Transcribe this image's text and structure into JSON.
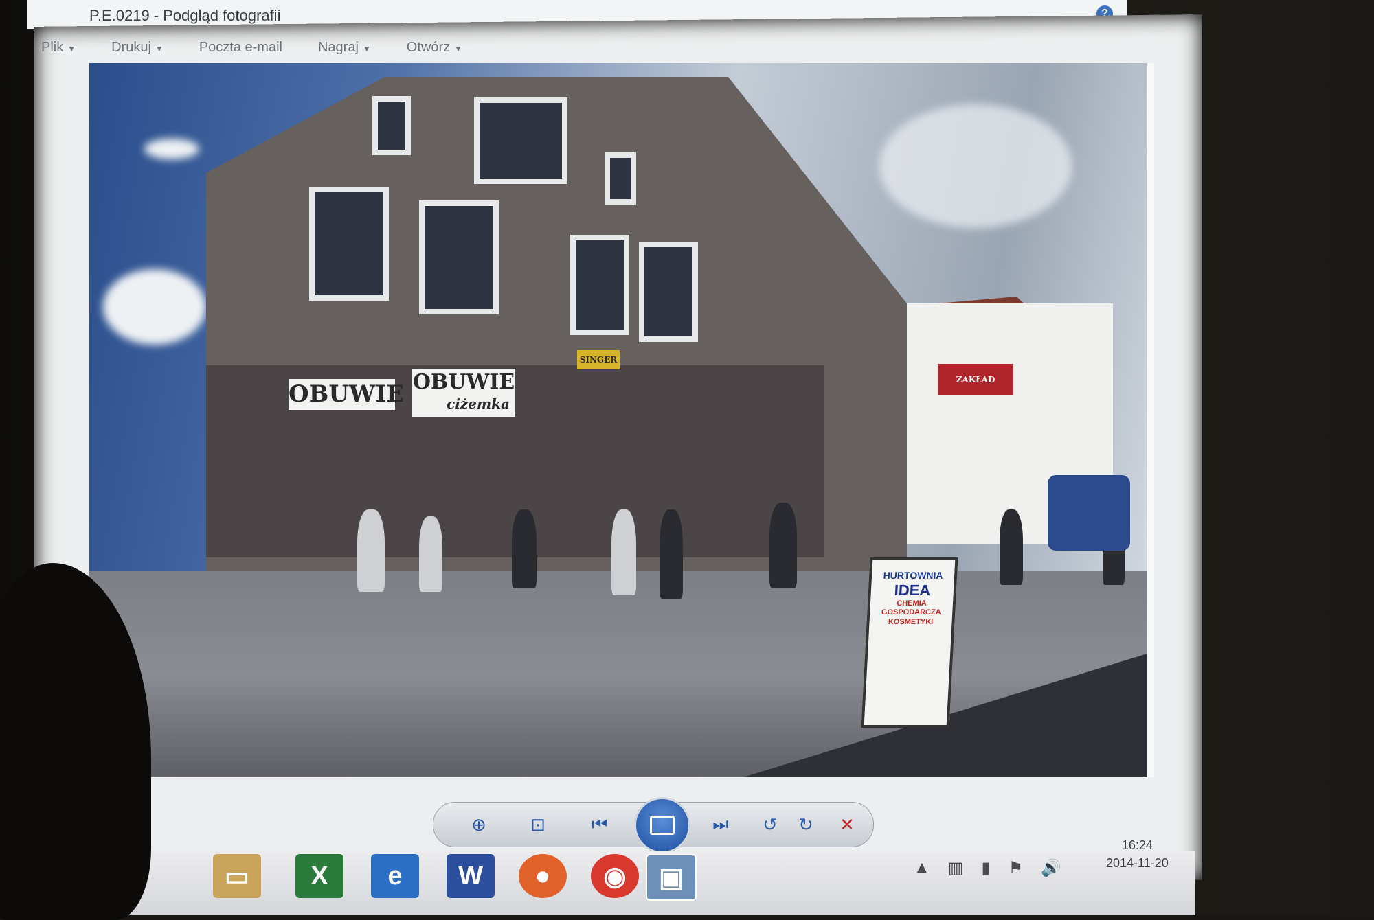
{
  "window": {
    "title": "P.E.0219 - Podgląd fotografii",
    "help_glyph": "?"
  },
  "menu": {
    "items": [
      {
        "label": "Plik"
      },
      {
        "label": "Drukuj"
      },
      {
        "label": "Poczta e-mail"
      },
      {
        "label": "Nagraj"
      },
      {
        "label": "Otwórz"
      }
    ]
  },
  "photo": {
    "shop_sign_1": "OBUWIE",
    "shop_sign_2": "OBUWIE",
    "shop_sign_2_sub": "ciżemka",
    "board_line1": "HURTOWNIA",
    "board_line2": "IDEA",
    "board_line3": "CHEMIA GOSPODARCZA KOSMETYKI",
    "awning_text": "ZAKŁAD",
    "shop_plate": "SINGER"
  },
  "caption": {
    "left": "",
    "right": ""
  },
  "toolbar": {
    "zoom_glyph": "⊕",
    "fit_glyph": "⊡",
    "prev_glyph": "⏮",
    "next_glyph": "⏭",
    "rotate_ccw_glyph": "↺",
    "rotate_cw_glyph": "↻",
    "delete_glyph": "✕"
  },
  "taskbar": {
    "apps": [
      {
        "name": "explorer",
        "glyph": "▭"
      },
      {
        "name": "excel",
        "glyph": "X"
      },
      {
        "name": "ie",
        "glyph": "e"
      },
      {
        "name": "word",
        "glyph": "W"
      },
      {
        "name": "firefox",
        "glyph": "●"
      },
      {
        "name": "chrome",
        "glyph": "◉"
      },
      {
        "name": "photo-viewer",
        "glyph": "▣"
      }
    ],
    "tray_glyphs": [
      "▲",
      "▥",
      "▮",
      "⚑",
      "🔊"
    ],
    "clock_time": "16:24",
    "clock_date": "2014-11-20"
  },
  "colors": {
    "accent": "#2b5aa6",
    "delete_red": "#c0292b"
  }
}
